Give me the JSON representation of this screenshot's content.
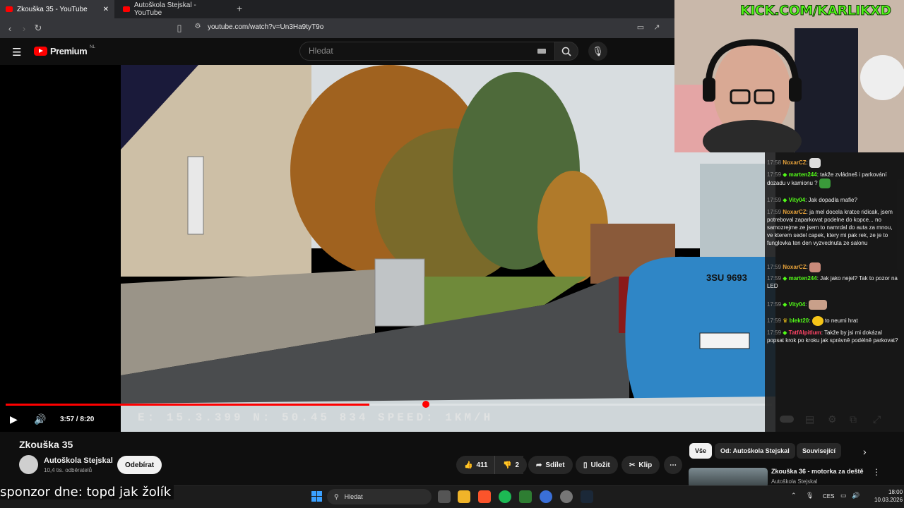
{
  "tabs": [
    {
      "label": "Zkouška 35 - YouTube",
      "active": true
    },
    {
      "label": "Autoškola Stejskal - YouTube",
      "active": false
    }
  ],
  "address": {
    "url": "youtube.com/watch?v=Un3Ha9tyT9o"
  },
  "yt": {
    "brand": "Premium",
    "region": "NL",
    "search_placeholder": "Hledat"
  },
  "player": {
    "hud": "E: 15.3.399  N: 50.45 834 SPEED:  1KM/H",
    "time": "3:57 / 8:20",
    "progress": 0.475,
    "plate": "3SU 9693"
  },
  "video": {
    "title": "Zkouška 35",
    "channel": "Autoškola Stejskal",
    "subscribers": "10,4 tis. odběratelů",
    "subscribe_label": "Odebírat",
    "likes": "411",
    "dislikes": "2",
    "share": "Sdílet",
    "save": "Uložit",
    "clip": "Klip",
    "more": "⋯"
  },
  "related": {
    "chips": [
      "Vše",
      "Od: Autoškola Stejskal",
      "Související"
    ],
    "item_title": "Zkouška 36 - motorka za deště",
    "item_channel": "Autoškola Stejskal"
  },
  "stream": {
    "handle": "KICK.COM/KARLIKXD",
    "sponsor": "sponzor dne: topd jak žolík"
  },
  "chat": [
    {
      "time": "17:58",
      "user": "NoxarCZ",
      "color": "#e8a33b",
      "text": ""
    },
    {
      "time": "17:59",
      "user": "marten244",
      "color": "#53fc18",
      "text": "takže zvládneš i parkování dozadu v kamionu ?"
    },
    {
      "time": "17:59",
      "user": "Vity04",
      "color": "#53fc18",
      "text": "Jak dopadla mafie?"
    },
    {
      "time": "17:59",
      "user": "NoxarCZ",
      "color": "#e8a33b",
      "text": "ja mel docela kratce ridicak, jsem potreboval zaparkovat podelne do kopce... no samozrejme ze jsem to namrdal do auta za mnou, ve kterem sedel capek, ktery mi pak rek, ze je to funglovka ten den vyzvednuta ze salonu"
    },
    {
      "time": "17:59",
      "user": "NoxarCZ",
      "color": "#e8a33b",
      "text": ""
    },
    {
      "time": "17:59",
      "user": "marten244",
      "color": "#53fc18",
      "text": "Jak jako nejel? Tak to pozor na LED"
    },
    {
      "time": "17:59",
      "user": "Vity04",
      "color": "#53fc18",
      "text": ""
    },
    {
      "time": "17:59",
      "user": "blekt20",
      "color": "#53fc18",
      "text": "to neumi hrat"
    },
    {
      "time": "17:59",
      "user": "TatfAlpitlum",
      "color": "#ff4466",
      "text": "Takže by jsi mi dokázal popsat krok po kroku jak správně podélně parkovat?"
    }
  ],
  "taskbar": {
    "search": "Hledat",
    "lang": "CES",
    "time": "18:00",
    "date": "10.03.2026"
  }
}
